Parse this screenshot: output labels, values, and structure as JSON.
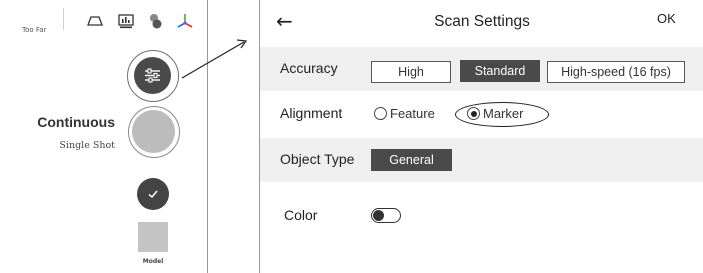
{
  "capture_panel": {
    "distance_status": "Too Far",
    "toolbar_icons": [
      "trapezoid-icon",
      "monitor-chart-icon",
      "blobs-icon",
      "axes-icon"
    ],
    "modes": {
      "active": "Continuous",
      "inactive": "Single Shot"
    },
    "model_label": "Model"
  },
  "settings": {
    "title": "Scan Settings",
    "back_icon": "back-arrow-icon",
    "ok_label": "OK",
    "accuracy": {
      "label": "Accuracy",
      "options": [
        "High",
        "Standard",
        "High-speed (16 fps)"
      ],
      "selected": "Standard"
    },
    "alignment": {
      "label": "Alignment",
      "options": [
        "Feature",
        "Marker"
      ],
      "selected": "Marker"
    },
    "object_type": {
      "label": "Object Type",
      "value": "General"
    },
    "color": {
      "label": "Color",
      "enabled": false
    }
  },
  "colors": {
    "dark": "#4a4a4a",
    "row_shade": "#efefef",
    "divider": "#9a9a9a"
  }
}
